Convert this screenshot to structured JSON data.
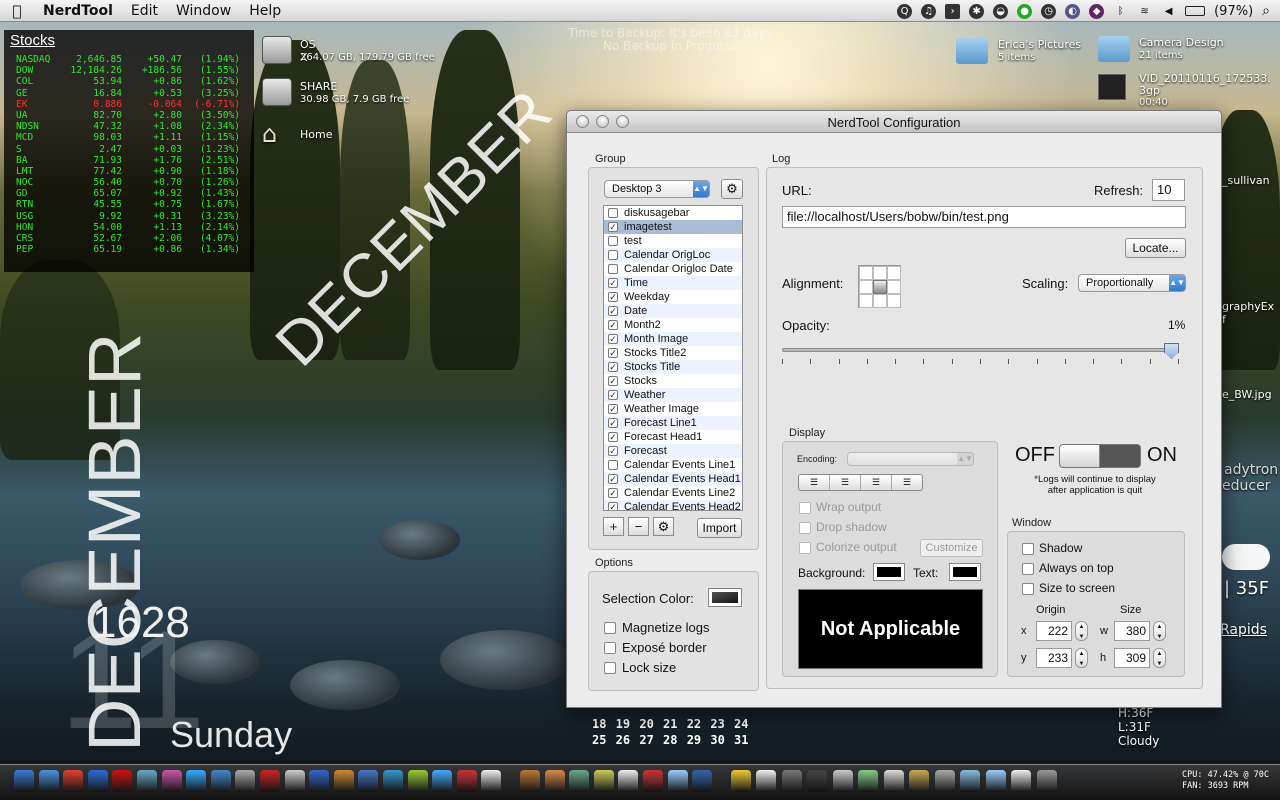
{
  "menubar": {
    "apple": "",
    "items": [
      "NerdTool",
      "Edit",
      "Window",
      "Help"
    ],
    "battery": "(97%)"
  },
  "stocks": {
    "title": "Stocks",
    "rows": [
      {
        "sym": "NASDAQ",
        "price": "2,646.85",
        "chg": "+50.47",
        "pct": "(1.94%)"
      },
      {
        "sym": "DOW",
        "price": "12,184.26",
        "chg": "+186.56",
        "pct": "(1.55%)"
      },
      {
        "sym": "COL",
        "price": "53.94",
        "chg": "+0.86",
        "pct": "(1.62%)"
      },
      {
        "sym": "GE",
        "price": "16.84",
        "chg": "+0.53",
        "pct": "(3.25%)"
      },
      {
        "sym": "EK",
        "price": "0.886",
        "chg": "-0.064",
        "pct": "(-6.71%)",
        "neg": true
      },
      {
        "sym": "UA",
        "price": "82.70",
        "chg": "+2.80",
        "pct": "(3.50%)"
      },
      {
        "sym": "NDSN",
        "price": "47.32",
        "chg": "+1.08",
        "pct": "(2.34%)"
      },
      {
        "sym": "MCD",
        "price": "98.03",
        "chg": "+1.11",
        "pct": "(1.15%)"
      },
      {
        "sym": "S",
        "price": "2.47",
        "chg": "+0.03",
        "pct": "(1.23%)"
      },
      {
        "sym": "BA",
        "price": "71.93",
        "chg": "+1.76",
        "pct": "(2.51%)"
      },
      {
        "sym": "LMT",
        "price": "77.42",
        "chg": "+0.90",
        "pct": "(1.18%)"
      },
      {
        "sym": "NOC",
        "price": "56.40",
        "chg": "+0.70",
        "pct": "(1.26%)"
      },
      {
        "sym": "GD",
        "price": "65.07",
        "chg": "+0.92",
        "pct": "(1.43%)"
      },
      {
        "sym": "RTN",
        "price": "45.55",
        "chg": "+0.75",
        "pct": "(1.67%)"
      },
      {
        "sym": "USG",
        "price": "9.92",
        "chg": "+0.31",
        "pct": "(3.23%)"
      },
      {
        "sym": "HON",
        "price": "54.00",
        "chg": "+1.13",
        "pct": "(2.14%)"
      },
      {
        "sym": "CRS",
        "price": "52.67",
        "chg": "+2.06",
        "pct": "(4.07%)"
      },
      {
        "sym": "PEP",
        "price": "65.19",
        "chg": "+0.86",
        "pct": "(1.34%)"
      }
    ]
  },
  "desktop": {
    "osx_name": "OS X",
    "osx_info": "264.07 GB, 179.79 GB free",
    "share_name": "SHARE",
    "share_info": "30.98 GB, 7.9 GB free",
    "home_name": "Home",
    "tm_line1": "Time to Backup: It's been 83 days",
    "tm_line2": "No Backup in Progress",
    "ericas_name": "Erica's Pictures",
    "ericas_info": "5 items",
    "camera_name": "Camera Design",
    "camera_info": "21 items",
    "vid_name1": "VID_20110116_172533.",
    "vid_name2": "3gp",
    "vid_info": "00:40",
    "month_diag": "DECEMBER",
    "month_vert": "DECEMBER",
    "day_num": "11",
    "time": "1628",
    "weekday": "Sunday",
    "right_sullivan": "_sullivan",
    "right_graphy": "graphyEx",
    "right_f": "f",
    "right_bw": "e_BW.jpg",
    "right_adytron": "adytron",
    "right_educer": "educer",
    "right_temp": "| 35F",
    "right_rapids": "Rapids",
    "right_hi": "H:36F",
    "right_lo": "L:31F",
    "right_cloudy": "Cloudy",
    "cal_row1": "18 19 20 21 22 23 24",
    "cal_row2": "25 26 27 28 29 30 31",
    "cpu": "CPU: 47.42% @ 70C",
    "fan": "FAN: 3693 RPM"
  },
  "window": {
    "title": "NerdTool Configuration",
    "group": {
      "label": "Group",
      "selected": "Desktop 3",
      "items": [
        {
          "label": "diskusagebar",
          "checked": false
        },
        {
          "label": "imagetest",
          "checked": true,
          "selected": true
        },
        {
          "label": "test",
          "checked": false
        },
        {
          "label": "Calendar OrigLoc",
          "checked": false
        },
        {
          "label": "Calendar Origloc Date",
          "checked": false
        },
        {
          "label": "Time",
          "checked": true
        },
        {
          "label": "Weekday",
          "checked": true
        },
        {
          "label": "Date",
          "checked": true
        },
        {
          "label": "Month2",
          "checked": true
        },
        {
          "label": "Month Image",
          "checked": true
        },
        {
          "label": "Stocks Title2",
          "checked": true
        },
        {
          "label": "Stocks Title",
          "checked": true
        },
        {
          "label": "Stocks",
          "checked": true
        },
        {
          "label": "Weather",
          "checked": true
        },
        {
          "label": "Weather Image",
          "checked": true
        },
        {
          "label": "Forecast Line1",
          "checked": true
        },
        {
          "label": "Forecast Head1",
          "checked": true
        },
        {
          "label": "Forecast",
          "checked": true
        },
        {
          "label": "Calendar Events Line1",
          "checked": false
        },
        {
          "label": "Calendar Events Head1",
          "checked": true
        },
        {
          "label": "Calendar Events Line2",
          "checked": true
        },
        {
          "label": "Calendar Events Head2",
          "checked": true
        }
      ],
      "add": "+",
      "remove": "−",
      "import": "Import"
    },
    "options": {
      "label": "Options",
      "selection_color": "Selection Color:",
      "magnetize": "Magnetize logs",
      "expose": "Exposé border",
      "lock": "Lock size"
    },
    "log": {
      "label": "Log",
      "url_label": "URL:",
      "url_value": "file://localhost/Users/bobw/bin/test.png",
      "refresh_label": "Refresh:",
      "refresh_value": "10",
      "locate": "Locate...",
      "alignment_label": "Alignment:",
      "scaling_label": "Scaling:",
      "scaling_value": "Proportionally",
      "opacity_label": "Opacity:",
      "opacity_value": "1%",
      "opacity_fraction": 1.0
    },
    "display": {
      "label": "Display",
      "encoding_label": "Encoding:",
      "wrap": "Wrap output",
      "shadow": "Drop shadow",
      "colorize": "Colorize output",
      "customize": "Customize",
      "background_label": "Background:",
      "text_label": "Text:",
      "preview": "Not Applicable"
    },
    "toggle": {
      "off": "OFF",
      "on": "ON",
      "note1": "*Logs will continue to display",
      "note2": "after application is quit"
    },
    "win": {
      "label": "Window",
      "shadow": "Shadow",
      "always_top": "Always on top",
      "size_screen": "Size to screen",
      "origin_label": "Origin",
      "size_label": "Size",
      "x_label": "x",
      "y_label": "y",
      "w_label": "w",
      "h_label": "h",
      "x": "222",
      "y": "233",
      "w": "380",
      "h": "309"
    }
  }
}
